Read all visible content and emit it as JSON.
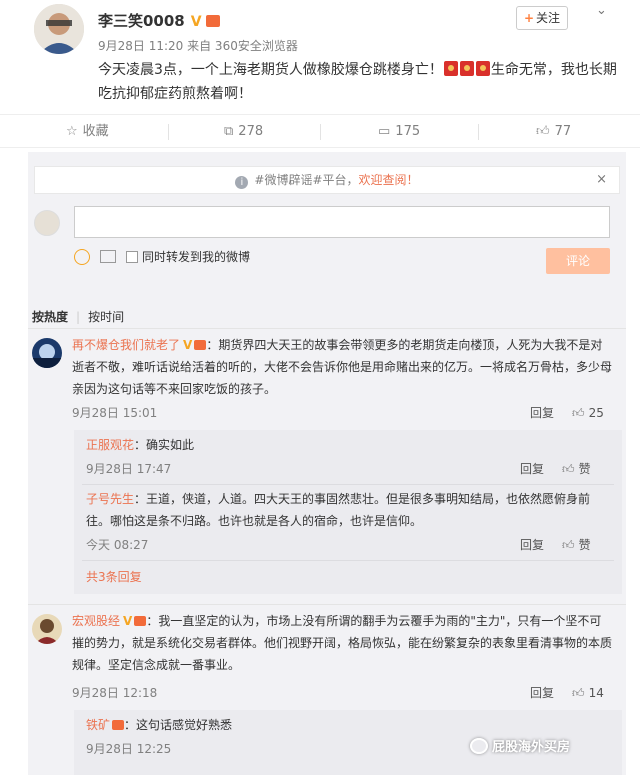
{
  "post": {
    "user": "李三笑0008",
    "vip_badge": "V",
    "meta": "9月28日 11:20 来自 360安全浏览器",
    "follow_label": "关注",
    "text_part1": "今天凌晨3点，一个上海老期货人做橡胶爆仓跳楼身亡！",
    "text_part2": "生命无常，我也长期吃抗抑郁症药煎熬着啊！",
    "actions": {
      "favorite": "收藏",
      "repost": "278",
      "comment": "175",
      "like": "77"
    }
  },
  "notice": {
    "part1": "#微博辟谣#平台，",
    "part2": "欢迎查阅！",
    "close": "×"
  },
  "composer": {
    "forward_label": "同时转发到我的微博",
    "submit_label": "评论"
  },
  "sort": {
    "hot": "按热度",
    "time": "按时间"
  },
  "comments": [
    {
      "name": "再不爆仓我们就老了",
      "text": "：期货界四大天王的故事会带领更多的老期货走向楼顶，人死为大我不是对逝者不敬，难听话说给活着的听的，大佬不会告诉你他是用命赌出来的亿万。一将成名万骨枯，多少母亲因为这句话等不来回家吃饭的孩子。",
      "time": "9月28日 15:01",
      "reply_label": "回复",
      "likes": "25",
      "replies": [
        {
          "name": "正服观花",
          "text": "：确实如此",
          "time": "9月28日 17:47",
          "reply_label": "回复",
          "like_label": "赞"
        },
        {
          "name": "子号先生",
          "text": "：王道，侠道，人道。四大天王的事固然悲壮。但是很多事明知结局，也依然愿俯身前往。哪怕这是条不归路。也许也就是各人的宿命，也许是信仰。",
          "time": "今天 08:27",
          "reply_label": "回复",
          "like_label": "赞"
        }
      ],
      "more": "共3条回复"
    },
    {
      "name": "宏观股经",
      "text": "：我一直坚定的认为，市场上没有所谓的翻手为云覆手为雨的\"主力\"，只有一个坚不可摧的势力，就是系统化交易者群体。他们视野开阔，格局恢弘，能在纷繁复杂的表象里看清事物的本质规律。坚定信念成就一番事业。",
      "time": "9月28日 12:18",
      "reply_label": "回复",
      "likes": "14",
      "replies": [
        {
          "name": "铁矿",
          "text": "：这句话感觉好熟悉",
          "time": "9月28日 12:25"
        }
      ]
    }
  ],
  "watermark": "屁股海外买房",
  "colors": {
    "accent": "#eb7350",
    "vip": "#f5a623",
    "submit": "#ffc09f",
    "panel": "#f2f2f5"
  }
}
